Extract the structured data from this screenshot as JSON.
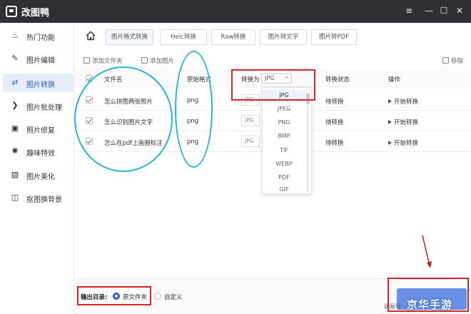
{
  "window": {
    "title": "改图鸭",
    "controls": {
      "menu": "≡",
      "minimize": "—",
      "maximize": "☐",
      "close": "✕"
    }
  },
  "sidebar": {
    "items": [
      {
        "label": "热门功能",
        "icon": "flame-icon",
        "glyph": "♨",
        "active": false
      },
      {
        "label": "图片编辑",
        "icon": "edit-icon",
        "glyph": "✎",
        "active": false
      },
      {
        "label": "图片转换",
        "icon": "swap-icon",
        "glyph": "⇄",
        "active": true
      },
      {
        "label": "图片批处理",
        "icon": "batch-icon",
        "glyph": "❯",
        "active": false
      },
      {
        "label": "照片修复",
        "icon": "repair-icon",
        "glyph": "▣",
        "active": false
      },
      {
        "label": "趣味特效",
        "icon": "effects-icon",
        "glyph": "✺",
        "active": false
      },
      {
        "label": "图片美化",
        "icon": "beautify-icon",
        "glyph": "▨",
        "active": false
      },
      {
        "label": "抠图换背景",
        "icon": "cutout-icon",
        "glyph": "◫",
        "active": false
      }
    ]
  },
  "tabs": [
    {
      "label": "图片格式转换",
      "active": true
    },
    {
      "label": "Heic转换",
      "active": false
    },
    {
      "label": "Raw转换",
      "active": false
    },
    {
      "label": "图片转文字",
      "active": false
    },
    {
      "label": "图片转PDF",
      "active": false
    }
  ],
  "toolbar": {
    "add_folder": "添加文件夹",
    "add_image": "添加图片",
    "remove": "移除"
  },
  "table": {
    "headers": {
      "filename": "文件名",
      "original_format": "原始格式",
      "convert_to": "转换为",
      "status": "转换状态",
      "action": "操作"
    },
    "selected_format": "JPG",
    "rows": [
      {
        "filename": "怎么拼图两张照片",
        "format": "png",
        "target": "JPG",
        "status": "待转换",
        "action": "开始转换",
        "checked": true
      },
      {
        "filename": "怎么识别图片文字",
        "format": "png",
        "target": "JPG",
        "status": "待转换",
        "action": "开始转换",
        "checked": true
      },
      {
        "filename": "怎么在pdf上画圈标注",
        "format": "png",
        "target": "JPG",
        "status": "待转换",
        "action": "开始转换",
        "checked": true
      }
    ]
  },
  "dropdown": {
    "options": [
      "JPG",
      "JPEG",
      "PNG",
      "BMP",
      "TIF",
      "WEBP",
      "PDF",
      "GIF"
    ],
    "selected": "JPG"
  },
  "bottom": {
    "output_label": "输出目录:",
    "option_original": "原文件夹",
    "option_custom": "自定义"
  },
  "watermark": {
    "text": "京华手游",
    "side_text": "润易导"
  },
  "colors": {
    "titlebar": "#2f3034",
    "accent": "#2f59c9",
    "annotation_red": "#d92525",
    "annotation_teal": "#2cb3d6",
    "convert_button": "#6b8fe6"
  }
}
